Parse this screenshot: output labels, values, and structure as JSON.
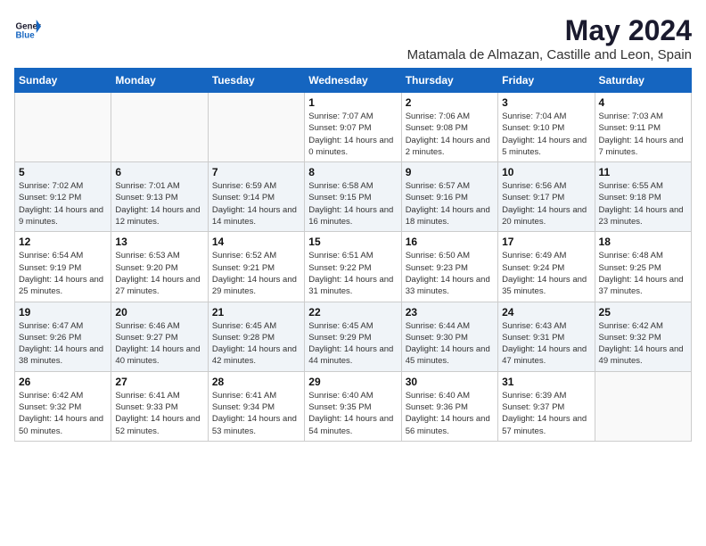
{
  "header": {
    "logo_general": "General",
    "logo_blue": "Blue",
    "title": "May 2024",
    "subtitle": "Matamala de Almazan, Castille and Leon, Spain"
  },
  "weekdays": [
    "Sunday",
    "Monday",
    "Tuesday",
    "Wednesday",
    "Thursday",
    "Friday",
    "Saturday"
  ],
  "weeks": [
    [
      {
        "day": "",
        "sunrise": "",
        "sunset": "",
        "daylight": ""
      },
      {
        "day": "",
        "sunrise": "",
        "sunset": "",
        "daylight": ""
      },
      {
        "day": "",
        "sunrise": "",
        "sunset": "",
        "daylight": ""
      },
      {
        "day": "1",
        "sunrise": "Sunrise: 7:07 AM",
        "sunset": "Sunset: 9:07 PM",
        "daylight": "Daylight: 14 hours and 0 minutes."
      },
      {
        "day": "2",
        "sunrise": "Sunrise: 7:06 AM",
        "sunset": "Sunset: 9:08 PM",
        "daylight": "Daylight: 14 hours and 2 minutes."
      },
      {
        "day": "3",
        "sunrise": "Sunrise: 7:04 AM",
        "sunset": "Sunset: 9:10 PM",
        "daylight": "Daylight: 14 hours and 5 minutes."
      },
      {
        "day": "4",
        "sunrise": "Sunrise: 7:03 AM",
        "sunset": "Sunset: 9:11 PM",
        "daylight": "Daylight: 14 hours and 7 minutes."
      }
    ],
    [
      {
        "day": "5",
        "sunrise": "Sunrise: 7:02 AM",
        "sunset": "Sunset: 9:12 PM",
        "daylight": "Daylight: 14 hours and 9 minutes."
      },
      {
        "day": "6",
        "sunrise": "Sunrise: 7:01 AM",
        "sunset": "Sunset: 9:13 PM",
        "daylight": "Daylight: 14 hours and 12 minutes."
      },
      {
        "day": "7",
        "sunrise": "Sunrise: 6:59 AM",
        "sunset": "Sunset: 9:14 PM",
        "daylight": "Daylight: 14 hours and 14 minutes."
      },
      {
        "day": "8",
        "sunrise": "Sunrise: 6:58 AM",
        "sunset": "Sunset: 9:15 PM",
        "daylight": "Daylight: 14 hours and 16 minutes."
      },
      {
        "day": "9",
        "sunrise": "Sunrise: 6:57 AM",
        "sunset": "Sunset: 9:16 PM",
        "daylight": "Daylight: 14 hours and 18 minutes."
      },
      {
        "day": "10",
        "sunrise": "Sunrise: 6:56 AM",
        "sunset": "Sunset: 9:17 PM",
        "daylight": "Daylight: 14 hours and 20 minutes."
      },
      {
        "day": "11",
        "sunrise": "Sunrise: 6:55 AM",
        "sunset": "Sunset: 9:18 PM",
        "daylight": "Daylight: 14 hours and 23 minutes."
      }
    ],
    [
      {
        "day": "12",
        "sunrise": "Sunrise: 6:54 AM",
        "sunset": "Sunset: 9:19 PM",
        "daylight": "Daylight: 14 hours and 25 minutes."
      },
      {
        "day": "13",
        "sunrise": "Sunrise: 6:53 AM",
        "sunset": "Sunset: 9:20 PM",
        "daylight": "Daylight: 14 hours and 27 minutes."
      },
      {
        "day": "14",
        "sunrise": "Sunrise: 6:52 AM",
        "sunset": "Sunset: 9:21 PM",
        "daylight": "Daylight: 14 hours and 29 minutes."
      },
      {
        "day": "15",
        "sunrise": "Sunrise: 6:51 AM",
        "sunset": "Sunset: 9:22 PM",
        "daylight": "Daylight: 14 hours and 31 minutes."
      },
      {
        "day": "16",
        "sunrise": "Sunrise: 6:50 AM",
        "sunset": "Sunset: 9:23 PM",
        "daylight": "Daylight: 14 hours and 33 minutes."
      },
      {
        "day": "17",
        "sunrise": "Sunrise: 6:49 AM",
        "sunset": "Sunset: 9:24 PM",
        "daylight": "Daylight: 14 hours and 35 minutes."
      },
      {
        "day": "18",
        "sunrise": "Sunrise: 6:48 AM",
        "sunset": "Sunset: 9:25 PM",
        "daylight": "Daylight: 14 hours and 37 minutes."
      }
    ],
    [
      {
        "day": "19",
        "sunrise": "Sunrise: 6:47 AM",
        "sunset": "Sunset: 9:26 PM",
        "daylight": "Daylight: 14 hours and 38 minutes."
      },
      {
        "day": "20",
        "sunrise": "Sunrise: 6:46 AM",
        "sunset": "Sunset: 9:27 PM",
        "daylight": "Daylight: 14 hours and 40 minutes."
      },
      {
        "day": "21",
        "sunrise": "Sunrise: 6:45 AM",
        "sunset": "Sunset: 9:28 PM",
        "daylight": "Daylight: 14 hours and 42 minutes."
      },
      {
        "day": "22",
        "sunrise": "Sunrise: 6:45 AM",
        "sunset": "Sunset: 9:29 PM",
        "daylight": "Daylight: 14 hours and 44 minutes."
      },
      {
        "day": "23",
        "sunrise": "Sunrise: 6:44 AM",
        "sunset": "Sunset: 9:30 PM",
        "daylight": "Daylight: 14 hours and 45 minutes."
      },
      {
        "day": "24",
        "sunrise": "Sunrise: 6:43 AM",
        "sunset": "Sunset: 9:31 PM",
        "daylight": "Daylight: 14 hours and 47 minutes."
      },
      {
        "day": "25",
        "sunrise": "Sunrise: 6:42 AM",
        "sunset": "Sunset: 9:32 PM",
        "daylight": "Daylight: 14 hours and 49 minutes."
      }
    ],
    [
      {
        "day": "26",
        "sunrise": "Sunrise: 6:42 AM",
        "sunset": "Sunset: 9:32 PM",
        "daylight": "Daylight: 14 hours and 50 minutes."
      },
      {
        "day": "27",
        "sunrise": "Sunrise: 6:41 AM",
        "sunset": "Sunset: 9:33 PM",
        "daylight": "Daylight: 14 hours and 52 minutes."
      },
      {
        "day": "28",
        "sunrise": "Sunrise: 6:41 AM",
        "sunset": "Sunset: 9:34 PM",
        "daylight": "Daylight: 14 hours and 53 minutes."
      },
      {
        "day": "29",
        "sunrise": "Sunrise: 6:40 AM",
        "sunset": "Sunset: 9:35 PM",
        "daylight": "Daylight: 14 hours and 54 minutes."
      },
      {
        "day": "30",
        "sunrise": "Sunrise: 6:40 AM",
        "sunset": "Sunset: 9:36 PM",
        "daylight": "Daylight: 14 hours and 56 minutes."
      },
      {
        "day": "31",
        "sunrise": "Sunrise: 6:39 AM",
        "sunset": "Sunset: 9:37 PM",
        "daylight": "Daylight: 14 hours and 57 minutes."
      },
      {
        "day": "",
        "sunrise": "",
        "sunset": "",
        "daylight": ""
      }
    ]
  ]
}
